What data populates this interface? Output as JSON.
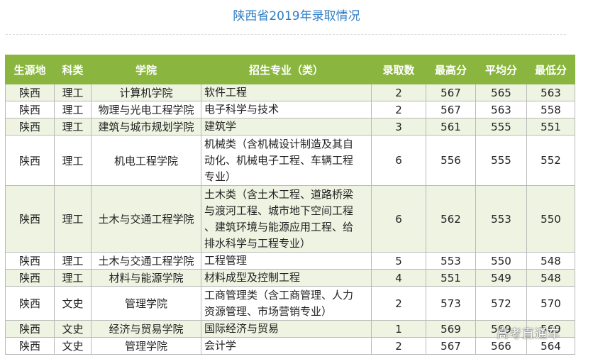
{
  "title": "陕西省2019年录取情况",
  "headers": [
    "生源地",
    "科类",
    "学院",
    "招生专业（类）",
    "录取数",
    "最高分",
    "平均分",
    "最低分"
  ],
  "rows": [
    {
      "region": "陕西",
      "category": "理工",
      "college": "计算机学院",
      "major": [
        "软件工程"
      ],
      "count": "2",
      "max": "567",
      "avg": "565",
      "min": "563"
    },
    {
      "region": "陕西",
      "category": "理工",
      "college": "物理与光电工程学院",
      "major": [
        "电子科学与技术"
      ],
      "count": "2",
      "max": "567",
      "avg": "563",
      "min": "558"
    },
    {
      "region": "陕西",
      "category": "理工",
      "college": "建筑与城市规划学院",
      "major": [
        "建筑学"
      ],
      "count": "3",
      "max": "561",
      "avg": "555",
      "min": "551"
    },
    {
      "region": "陕西",
      "category": "理工",
      "college": "机电工程学院",
      "major": [
        "机械类（含机械设计制造及其自",
        "动化、机械电子工程、车辆工程",
        "专业）"
      ],
      "count": "6",
      "max": "556",
      "avg": "555",
      "min": "552"
    },
    {
      "region": "陕西",
      "category": "理工",
      "college": "土木与交通工程学院",
      "major": [
        "土木类（含土木工程、道路桥梁",
        "与渡河工程、城市地下空间工程",
        "、建筑环境与能源应用工程、给",
        "排水科学与工程专业）"
      ],
      "count": "6",
      "max": "562",
      "avg": "553",
      "min": "550"
    },
    {
      "region": "陕西",
      "category": "理工",
      "college": "土木与交通工程学院",
      "major": [
        "工程管理"
      ],
      "count": "5",
      "max": "553",
      "avg": "550",
      "min": "548"
    },
    {
      "region": "陕西",
      "category": "理工",
      "college": "材料与能源学院",
      "major": [
        "材料成型及控制工程"
      ],
      "count": "4",
      "max": "551",
      "avg": "549",
      "min": "548"
    },
    {
      "region": "陕西",
      "category": "文史",
      "college": "管理学院",
      "major": [
        "工商管理类（含工商管理、人力",
        "资源管理、市场营销专业）"
      ],
      "count": "2",
      "max": "573",
      "avg": "572",
      "min": "570"
    },
    {
      "region": "陕西",
      "category": "文史",
      "college": "经济与贸易学院",
      "major": [
        "国际经济与贸易"
      ],
      "count": "1",
      "max": "569",
      "avg": "569",
      "min": "569"
    },
    {
      "region": "陕西",
      "category": "文史",
      "college": "管理学院",
      "major": [
        "会计学"
      ],
      "count": "2",
      "max": "567",
      "avg": "566",
      "min": "564"
    }
  ],
  "watermark": "高考直通车"
}
